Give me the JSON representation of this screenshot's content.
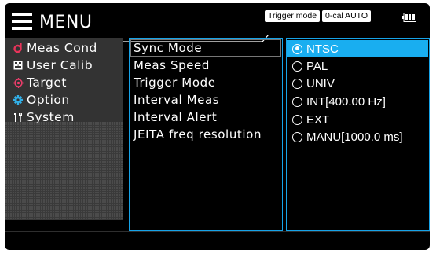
{
  "header": {
    "menu_label": "MENU",
    "trigger_mode": "Trigger mode",
    "zero_cal": "0-cal AUTO"
  },
  "sidebar": {
    "items": [
      {
        "label": "Meas Cond",
        "icon": "meas-cond-icon",
        "active": true
      },
      {
        "label": "User Calib",
        "icon": "user-calib-icon"
      },
      {
        "label": "Target",
        "icon": "target-icon"
      },
      {
        "label": "Option",
        "icon": "gear-icon"
      },
      {
        "label": "System",
        "icon": "tools-icon"
      }
    ]
  },
  "submenu": {
    "items": [
      {
        "label": "Sync Mode",
        "selected": true
      },
      {
        "label": "Meas Speed"
      },
      {
        "label": "Trigger Mode"
      },
      {
        "label": "Interval Meas"
      },
      {
        "label": "Interval Alert"
      },
      {
        "label": "JEITA freq resolution"
      }
    ]
  },
  "options": {
    "items": [
      {
        "label": "NTSC",
        "selected": true
      },
      {
        "label": "PAL"
      },
      {
        "label": "UNIV"
      },
      {
        "label": "INT[400.00 Hz]"
      },
      {
        "label": "EXT"
      },
      {
        "label": "MANU[1000.0 ms]"
      }
    ]
  },
  "colors": {
    "accent": "#19aef0",
    "background": "#000000",
    "meas_cond_icon": "#e8345a",
    "target_icon": "#ee3d6b",
    "option_icon": "#32b0e8"
  }
}
